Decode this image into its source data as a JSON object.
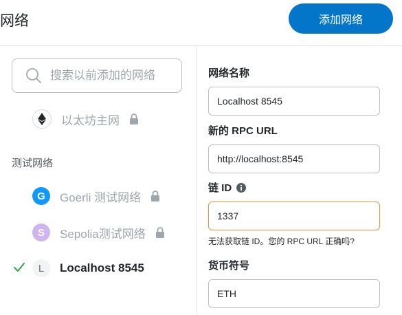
{
  "header": {
    "title": "网络",
    "add_button": "添加网络"
  },
  "sidebar": {
    "search_placeholder": "搜索以前添加的网络",
    "main_network": {
      "label": "以太坊主网",
      "locked": true
    },
    "test_section_label": "测试网络",
    "test_networks": [
      {
        "letter": "G",
        "label": "Goerli 测试网络",
        "color": "#1098fc",
        "locked": true
      },
      {
        "letter": "S",
        "label": "Sepolia测试网络",
        "color": "#cfb5f0",
        "locked": true
      }
    ],
    "custom_network": {
      "letter": "L",
      "label": "Localhost 8545",
      "selected": true
    }
  },
  "form": {
    "network_name": {
      "label": "网络名称",
      "value": "Localhost 8545"
    },
    "rpc_url": {
      "label": "新的 RPC URL",
      "value": "http://localhost:8545"
    },
    "chain_id": {
      "label": "链 ID",
      "value": "1337",
      "error": "无法获取链 ID。您的 RPC URL 正确吗?"
    },
    "currency_symbol": {
      "label": "货币符号",
      "value": "ETH"
    }
  },
  "colors": {
    "primary": "#0376c9",
    "error_border": "#e88f3a",
    "check": "#28a745"
  }
}
